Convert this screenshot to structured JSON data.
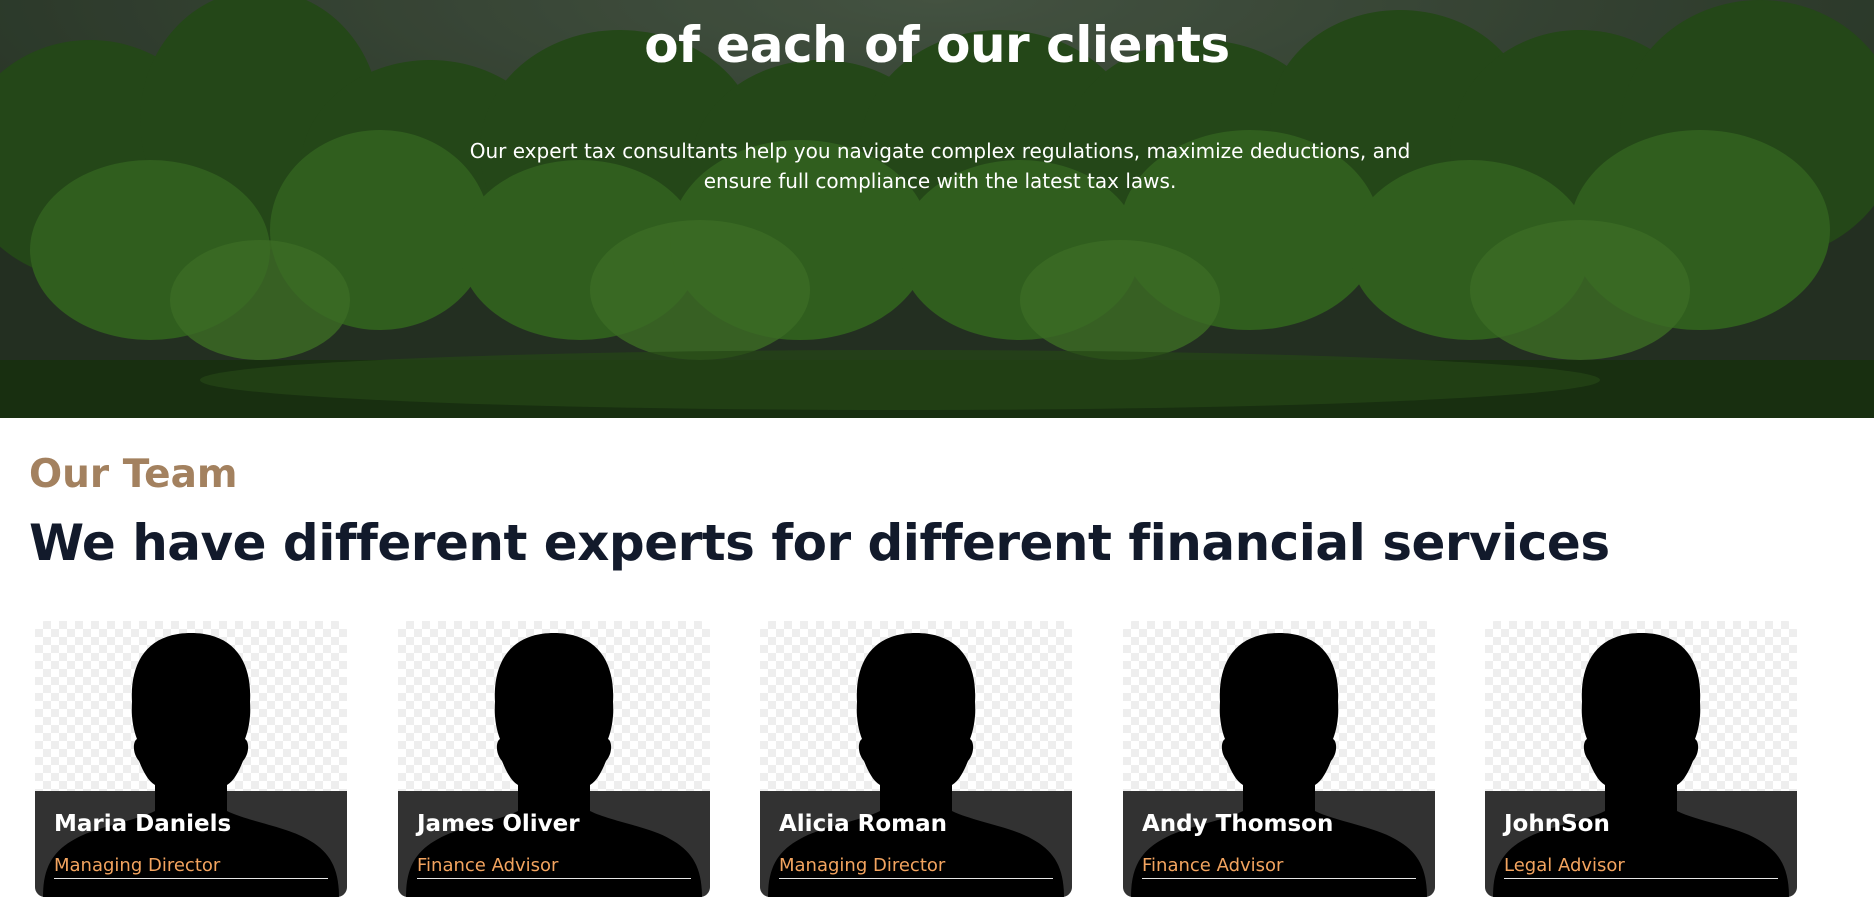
{
  "hero": {
    "title": "of each of our clients",
    "description_line1": "Our expert tax consultants help you navigate complex regulations, maximize deductions, and",
    "description_line2": "ensure full compliance with the latest tax laws."
  },
  "team": {
    "eyebrow": "Our Team",
    "heading": "We have different experts for different financial services",
    "members": [
      {
        "name": "Maria Daniels",
        "role": "Managing Director"
      },
      {
        "name": "James Oliver",
        "role": "Finance Advisor"
      },
      {
        "name": "Alicia Roman",
        "role": "Managing Director"
      },
      {
        "name": "Andy Thomson",
        "role": "Finance Advisor"
      },
      {
        "name": "JohnSon",
        "role": "Legal Advisor"
      }
    ]
  },
  "colors": {
    "accent": "#a3815f",
    "heading": "#121a2b",
    "role": "#f3a45f",
    "card_info_bg": "#323232"
  },
  "icons": {
    "avatar": "person-silhouette-icon"
  }
}
